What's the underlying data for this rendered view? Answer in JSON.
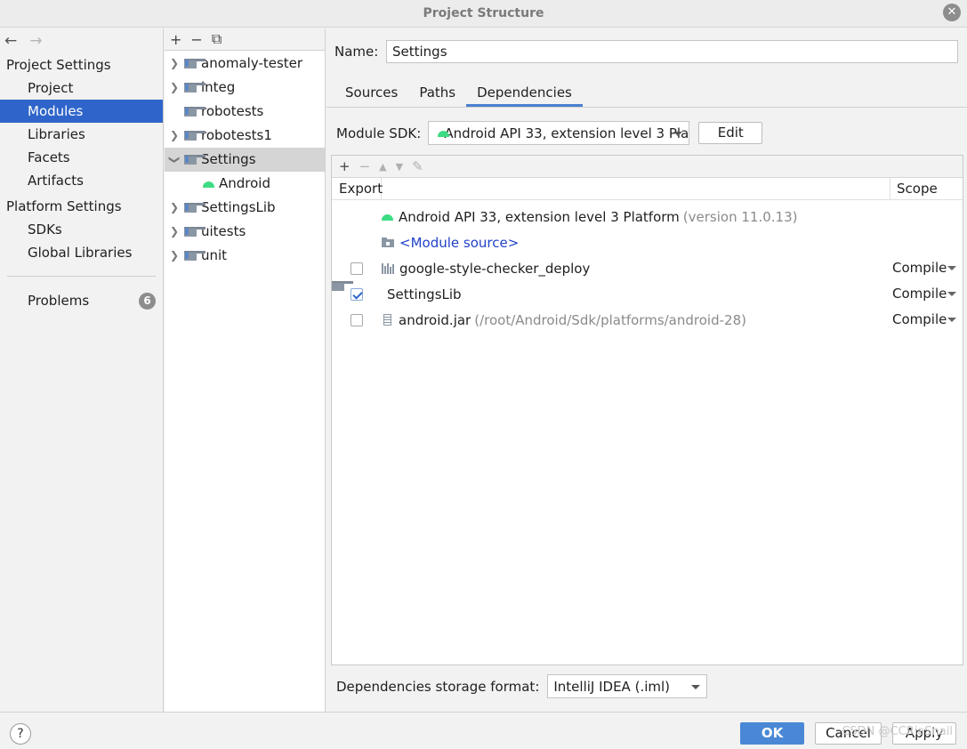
{
  "window": {
    "title": "Project Structure",
    "close_glyph": "✕"
  },
  "nav": {
    "back": "←",
    "forward": "→"
  },
  "sidebar": {
    "project_settings_title": "Project Settings",
    "project_items": [
      "Project",
      "Modules",
      "Libraries",
      "Facets",
      "Artifacts"
    ],
    "selected": "Modules",
    "platform_settings_title": "Platform Settings",
    "platform_items": [
      "SDKs",
      "Global Libraries"
    ],
    "problems_label": "Problems",
    "problems_count": "6"
  },
  "module_tree": {
    "toolbar": {
      "add": "+",
      "remove": "−",
      "copy": "⧉"
    },
    "items": [
      {
        "label": "anomaly-tester",
        "expanded": false
      },
      {
        "label": "integ",
        "expanded": false
      },
      {
        "label": "robotests",
        "expanded": null
      },
      {
        "label": "robotests1",
        "expanded": false
      },
      {
        "label": "Settings",
        "expanded": true
      },
      {
        "label": "Android",
        "child": true
      },
      {
        "label": "SettingsLib",
        "expanded": false
      },
      {
        "label": "uitests",
        "expanded": false
      },
      {
        "label": "unit",
        "expanded": false
      }
    ]
  },
  "module": {
    "name_label": "Name:",
    "name_value": "Settings",
    "tabs": [
      "Sources",
      "Paths",
      "Dependencies"
    ],
    "active_tab": "Dependencies",
    "sdk_label": "Module SDK:",
    "sdk_value": "Android API 33, extension level 3 Pla",
    "edit_label": "Edit"
  },
  "dependencies": {
    "toolbar": {
      "add": "+",
      "remove": "−",
      "up": "▲",
      "down": "▼",
      "edit": "✎"
    },
    "header_export": "Export",
    "header_scope": "Scope",
    "rows": [
      {
        "name": "Android API 33, extension level 3 Platform",
        "detail": "(version 11.0.13)",
        "icon": "android-icon",
        "checkbox": null,
        "scope": ""
      },
      {
        "name": "<Module source>",
        "detail": "",
        "icon": "module-source-icon",
        "checkbox": null,
        "scope": ""
      },
      {
        "name": "google-style-checker_deploy",
        "detail": "",
        "icon": "library-icon",
        "checkbox": false,
        "scope": "Compile"
      },
      {
        "name": "SettingsLib",
        "detail": "",
        "icon": "module-folder-icon",
        "checkbox": true,
        "scope": "Compile"
      },
      {
        "name": "android.jar",
        "detail": "(/root/Android/Sdk/platforms/android-28)",
        "icon": "jar-icon",
        "checkbox": false,
        "scope": "Compile"
      }
    ],
    "storage_label": "Dependencies storage format:",
    "storage_value": "IntelliJ IDEA (.iml)"
  },
  "footer": {
    "help": "?",
    "ok": "OK",
    "cancel": "Cancel",
    "apply": "Apply",
    "watermark": "CSDN @CCRiaSnail"
  }
}
